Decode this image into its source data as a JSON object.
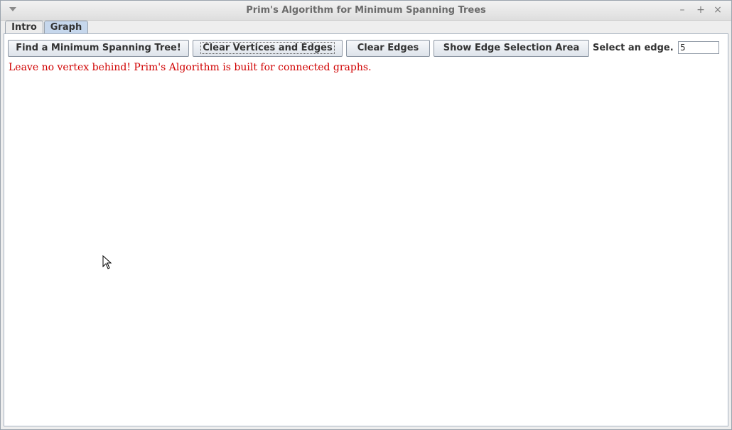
{
  "window": {
    "title": "Prim's Algorithm for Minimum Spanning Trees",
    "minimize": "–",
    "maximize": "+",
    "close": "×"
  },
  "tabs": [
    {
      "label": "Intro"
    },
    {
      "label": "Graph"
    }
  ],
  "toolbar": {
    "find_mst": "Find a Minimum Spanning Tree!",
    "clear_all": "Clear Vertices and Edges",
    "clear_edges": "Clear Edges",
    "show_area": "Show Edge Selection Area",
    "select_label": "Select an edge.",
    "select_value": "5"
  },
  "message": "Leave no vertex behind! Prim's Algorithm is built for connected graphs.",
  "colors": {
    "message": "#d00000",
    "active_tab": "#c6d7ec"
  }
}
